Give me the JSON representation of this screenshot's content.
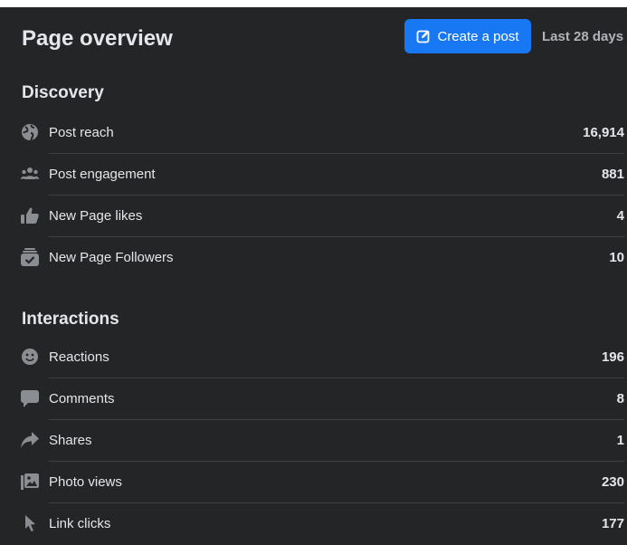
{
  "header": {
    "title": "Page overview",
    "create_post_label": "Create a post",
    "date_range": "Last 28 days"
  },
  "accent_color": "#1877f2",
  "sections": [
    {
      "title": "Discovery",
      "rows": [
        {
          "icon": "globe-icon",
          "label": "Post reach",
          "value": "16,914"
        },
        {
          "icon": "people-icon",
          "label": "Post engagement",
          "value": "881"
        },
        {
          "icon": "thumbs-up-icon",
          "label": "New Page likes",
          "value": "4"
        },
        {
          "icon": "follow-check-icon",
          "label": "New Page Followers",
          "value": "10"
        }
      ]
    },
    {
      "title": "Interactions",
      "rows": [
        {
          "icon": "smiley-icon",
          "label": "Reactions",
          "value": "196"
        },
        {
          "icon": "comment-bubble-icon",
          "label": "Comments",
          "value": "8"
        },
        {
          "icon": "share-arrow-icon",
          "label": "Shares",
          "value": "1"
        },
        {
          "icon": "photo-icon",
          "label": "Photo views",
          "value": "230"
        },
        {
          "icon": "cursor-icon",
          "label": "Link clicks",
          "value": "177"
        }
      ]
    }
  ]
}
